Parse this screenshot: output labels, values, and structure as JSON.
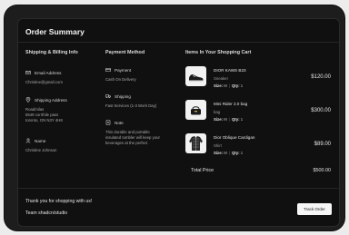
{
  "title": "Order Summary",
  "shipping": {
    "heading": "Shipping & Billing Info",
    "email_label": "Email Address",
    "email_value": "Christine@gmail.com",
    "address_label": "Shipping Address",
    "address_lines": [
      "Road/nilas",
      "5549 corrthile pass",
      "toronto, ON N3Y 4H8"
    ],
    "name_label": "Name",
    "name_value": "Christine Johnson"
  },
  "payment": {
    "heading": "Payment Method",
    "payment_label": "Payment",
    "payment_value": "Cash On Delivery",
    "shipping_label": "Shipping",
    "shipping_value": "Fast Services (1-3 Work Day)",
    "note_label": "Note",
    "note_lines": [
      "This durable and portable",
      "insulated tumbler will keep your",
      "beverages at the perfect"
    ]
  },
  "cart": {
    "heading": "Items In Your Shopping Cart",
    "size_label": "Size:",
    "qty_label": "Qty:",
    "items": [
      {
        "name": "DIOR KAWS B23",
        "category": "Sneaker",
        "size": "M",
        "qty": "1",
        "price": "$120.00",
        "icon": "sneaker-icon"
      },
      {
        "name": "Mini Rider 2.0 bag",
        "category": "bag",
        "size": "M",
        "qty": "1",
        "price": "$300.00",
        "icon": "bag-icon"
      },
      {
        "name": "Dior Oblique Cardigan",
        "category": "Shirt",
        "size": "M",
        "qty": "1",
        "price": "$89.00",
        "icon": "cardigan-icon"
      }
    ],
    "total_label": "Total Price",
    "total_value": "$500.00"
  },
  "footer": {
    "thanks": "Thank you for shopping with us!",
    "team": "Team shadcn/studio",
    "track_label": "Track Order"
  }
}
